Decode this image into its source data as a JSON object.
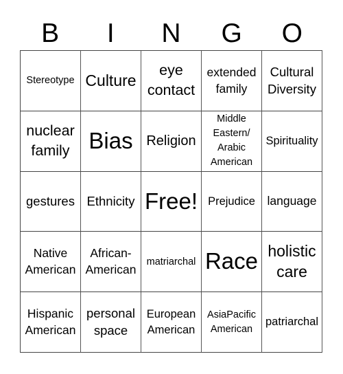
{
  "header": {
    "letters": [
      "B",
      "I",
      "N",
      "G",
      "O"
    ]
  },
  "cells": [
    [
      "Stereotype",
      "Culture",
      "eye\ncontact",
      "extended\nfamily",
      "Cultural\nDiversity"
    ],
    [
      "nuclear\nfamily",
      "Bias",
      "Religion",
      "Middle\nEastern/\nArabic\nAmerican",
      "Spirituality"
    ],
    [
      "gestures",
      "Ethnicity",
      "Free!",
      "Prejudice",
      "language"
    ],
    [
      "Native\nAmerican",
      "African-\nAmerican",
      "matriarchal",
      "Race",
      "holistic\ncare"
    ],
    [
      "Hispanic\nAmerican",
      "personal\nspace",
      "European\nAmerican",
      "AsiaPacific\nAmerican",
      "patriarchal"
    ]
  ]
}
